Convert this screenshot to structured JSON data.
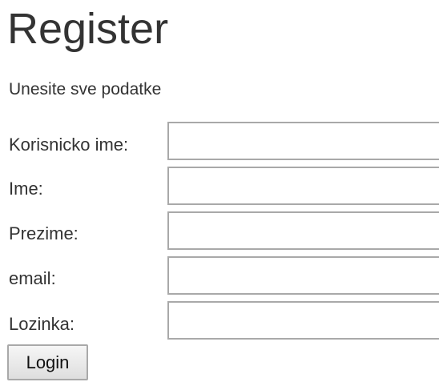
{
  "page": {
    "title": "Register",
    "subtitle": "Unesite sve podatke"
  },
  "form": {
    "fields": [
      {
        "label": "Korisnicko ime:",
        "value": "",
        "placeholder": ""
      },
      {
        "label": "Ime:",
        "value": "",
        "placeholder": ""
      },
      {
        "label": "Prezime:",
        "value": "",
        "placeholder": ""
      },
      {
        "label": "email:",
        "value": "",
        "placeholder": ""
      },
      {
        "label": "Lozinka:",
        "value": "",
        "placeholder": ""
      }
    ],
    "submit_label": "Login"
  },
  "colors": {
    "text": "#333333",
    "input_border": "#a9a9a9",
    "background": "#ffffff"
  }
}
